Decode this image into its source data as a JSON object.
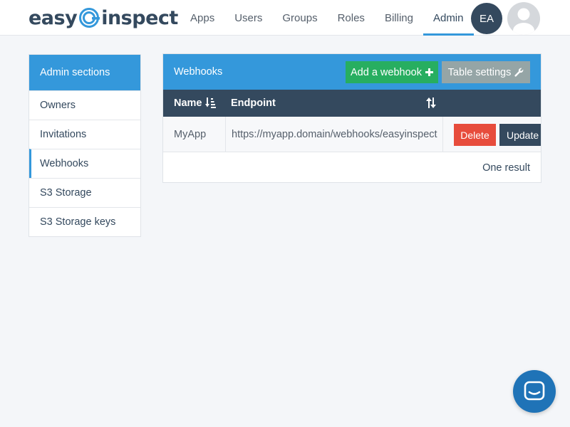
{
  "app": {
    "logo_left": "easy",
    "logo_right": "inspect"
  },
  "nav": {
    "items": [
      {
        "label": "Apps"
      },
      {
        "label": "Users"
      },
      {
        "label": "Groups"
      },
      {
        "label": "Roles"
      },
      {
        "label": "Billing"
      },
      {
        "label": "Admin",
        "active": true
      }
    ],
    "user_initials": "EA"
  },
  "sidebar": {
    "title": "Admin sections",
    "items": [
      {
        "label": "Owners"
      },
      {
        "label": "Invitations"
      },
      {
        "label": "Webhooks",
        "active": true
      },
      {
        "label": "S3 Storage"
      },
      {
        "label": "S3 Storage keys"
      }
    ]
  },
  "panel": {
    "title": "Webhooks",
    "add_button": "Add a webhook",
    "settings_button": "Table settings",
    "columns": {
      "name": "Name",
      "endpoint": "Endpoint"
    },
    "rows": [
      {
        "name": "MyApp",
        "endpoint": "https://myapp.domain/webhooks/easyinspect",
        "delete_label": "Delete",
        "update_label": "Update"
      }
    ],
    "result_count": "One result"
  },
  "icons": {
    "add": "plus-icon",
    "settings": "wrench-icon",
    "sort_name": "sort-amount-down-icon",
    "sort_endpoint": "sort-icon",
    "chat": "chat-bubble-icon"
  },
  "colors": {
    "primary": "#3498db",
    "dark": "#34495e",
    "success": "#27ae60",
    "danger": "#e74c3c",
    "muted": "#95a5a6",
    "chat": "#1f73b7"
  }
}
